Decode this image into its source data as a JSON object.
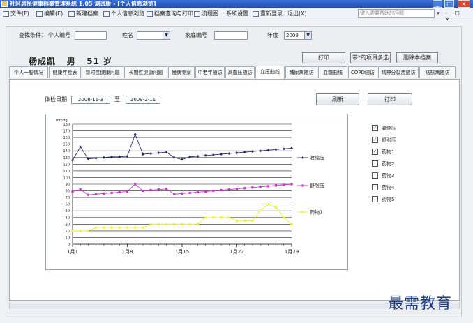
{
  "window": {
    "title": "社区居民健康档案管理系统 1.05 测试版 - [个人信息浏览]",
    "controls": [
      "_",
      "□",
      "×"
    ]
  },
  "menu": {
    "items": [
      "文件(F)",
      "编辑(E)",
      "新建档案",
      "个人信息浏览",
      "档案查询与打印",
      "流程图",
      "系统设置",
      "重新登录",
      "退出(X)"
    ],
    "help_placeholder": "键入需要帮助的问题",
    "mdi_controls": "- ▢ ×"
  },
  "filter": {
    "label": "查找条件：",
    "person_id_label": "个人编号",
    "name_label": "姓名",
    "family_id_label": "家庭编号",
    "year_label": "年度",
    "year_value": "2009"
  },
  "patient": {
    "name": "杨成凯",
    "sex": "男",
    "age": "51",
    "age_unit": "岁"
  },
  "actions": {
    "print": "打印",
    "multi_select": "带*的项目多选",
    "delete": "删除本档案"
  },
  "tabs": [
    "个人一般情况",
    "健康年检表",
    "暂时性健康问题",
    "长期性健康问题",
    "慢病专案",
    "中老年随访",
    "高血压随访",
    "血压曲线",
    "糖尿病随访",
    "血糖曲线",
    "COPD随访",
    "精神分裂症随访",
    "结核病随访"
  ],
  "active_tab": 7,
  "exam": {
    "date_label": "体检日期",
    "date_from": "2008-11-3",
    "date_sep": "至",
    "date_to": "2009-2-11",
    "refresh": "刷新",
    "print": "打印"
  },
  "legend_checks": [
    {
      "label": "收缩压",
      "checked": true
    },
    {
      "label": "舒张压",
      "checked": true
    },
    {
      "label": "药物1",
      "checked": true
    },
    {
      "label": "药物2",
      "checked": false
    },
    {
      "label": "药物3",
      "checked": false
    },
    {
      "label": "药物4",
      "checked": false
    },
    {
      "label": "药物5",
      "checked": false
    }
  ],
  "watermark": "最需教育",
  "chart_data": {
    "type": "line",
    "ylabel": "mmHg",
    "ylim": [
      0,
      180
    ],
    "yticks": [
      0,
      10,
      20,
      30,
      40,
      50,
      60,
      70,
      80,
      90,
      100,
      110,
      120,
      130,
      140,
      150,
      160,
      170,
      180
    ],
    "xlim": [
      1,
      29
    ],
    "xticks": [
      1,
      8,
      15,
      22,
      29
    ],
    "xtick_labels": [
      "1月1",
      "1月8",
      "1月15",
      "1月22",
      "1月29"
    ],
    "grid": true,
    "legend": "right",
    "series": [
      {
        "name": "收缩压",
        "color": "#2a2a6a",
        "marker": "diamond",
        "x": [
          1,
          2,
          3,
          4,
          5,
          6,
          7,
          8,
          9,
          10,
          11,
          12,
          13,
          14,
          15,
          16,
          17,
          18,
          19,
          20,
          21,
          22,
          23,
          24,
          25,
          26,
          27,
          28,
          29
        ],
        "values": [
          126,
          146,
          128,
          129,
          130,
          131,
          131,
          132,
          165,
          135,
          136,
          137,
          138,
          130,
          127,
          131,
          132,
          133,
          134,
          135,
          136,
          137,
          138,
          139,
          140,
          141,
          142,
          143,
          144
        ]
      },
      {
        "name": "舒张压",
        "color": "#cc33cc",
        "marker": "square",
        "x": [
          1,
          2,
          3,
          4,
          5,
          6,
          7,
          8,
          9,
          10,
          11,
          12,
          13,
          14,
          15,
          16,
          17,
          18,
          19,
          20,
          21,
          22,
          23,
          24,
          25,
          26,
          27,
          28,
          29
        ],
        "values": [
          79,
          82,
          74,
          75,
          76,
          77,
          78,
          79,
          90,
          80,
          81,
          82,
          83,
          75,
          76,
          77,
          78,
          79,
          80,
          81,
          82,
          83,
          84,
          85,
          86,
          87,
          88,
          89,
          90
        ]
      },
      {
        "name": "药物1",
        "color": "#f0f020",
        "marker": "circle",
        "x": [
          1,
          2,
          3,
          4,
          5,
          6,
          7,
          8,
          9,
          10,
          11,
          12,
          13,
          14,
          15,
          16,
          17,
          18,
          19,
          20,
          21,
          22,
          23,
          24,
          25,
          26,
          27,
          28,
          29
        ],
        "values": [
          20,
          20,
          20,
          25,
          25,
          25,
          25,
          25,
          25,
          25,
          30,
          30,
          30,
          30,
          30,
          30,
          30,
          40,
          40,
          40,
          40,
          35,
          35,
          35,
          50,
          60,
          55,
          40,
          30
        ]
      }
    ]
  }
}
